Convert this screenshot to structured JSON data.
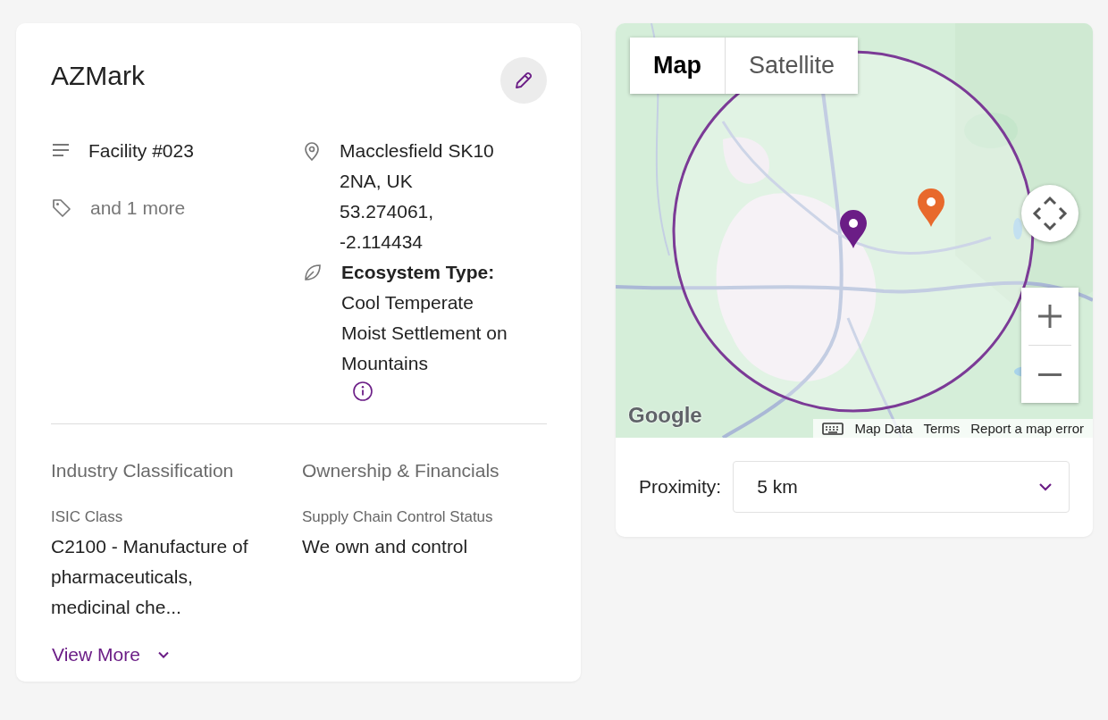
{
  "facility": {
    "name": "AZMark",
    "details": [
      {
        "kind": "list",
        "text": "Facility #023",
        "muted": false
      },
      {
        "kind": "tag",
        "text": "and 1 more",
        "muted": true
      }
    ],
    "location": {
      "address": "Macclesfield SK10 2NA, UK",
      "coordinates": "53.274061, -2.114434"
    },
    "ecosystem": {
      "label": "Ecosystem Type:",
      "value": "Cool Temperate Moist Settlement on Mountains"
    },
    "sections": [
      {
        "heading": "Industry Classification",
        "field_label": "ISIC Class",
        "field_value": "C2100 - Manufacture of pharmaceuticals, medicinal che..."
      },
      {
        "heading": "Ownership & Financials",
        "field_label": "Supply Chain Control Status",
        "field_value": "We own and control"
      }
    ],
    "view_more": "View More"
  },
  "map": {
    "tabs": [
      {
        "label": "Map",
        "selected": true
      },
      {
        "label": "Satellite",
        "selected": false
      }
    ],
    "markers": [
      {
        "color": "#6b1d86"
      },
      {
        "color": "#e8692c"
      }
    ],
    "logo": "Google",
    "attribution": [
      "Map Data",
      "Terms",
      "Report a map error"
    ]
  },
  "proximity": {
    "label": "Proximity:",
    "value": "5 km"
  }
}
